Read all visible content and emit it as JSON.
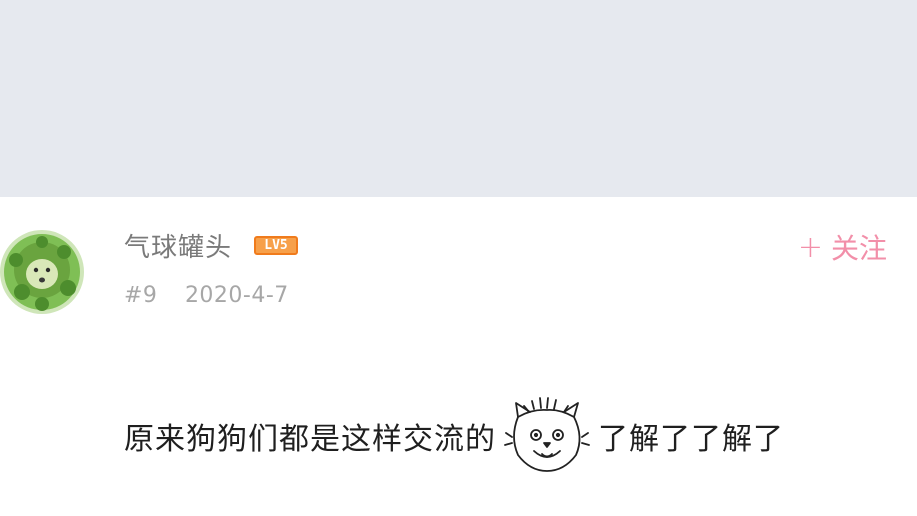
{
  "comment": {
    "username": "气球罐头",
    "level_label": "LV5",
    "follow_label": "关注",
    "floor": "#9",
    "date": "2020-4-7",
    "text_before_sticker": "原来狗狗们都是这样交流的",
    "text_after_sticker": "了解了了解了",
    "sticker_icon": "cat-face-sticker-icon",
    "colors": {
      "follow": "#f28fa9",
      "level_badge": "#f7a04a",
      "top_area": "#e6e9ef"
    }
  }
}
